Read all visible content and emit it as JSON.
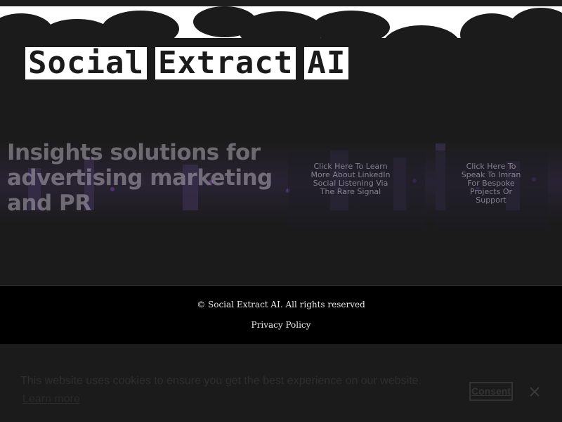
{
  "site": {
    "brand_words": [
      "Social",
      "Extract",
      "AI"
    ],
    "tagline": "Insights solutions for advertising marketing and PR"
  },
  "hero_links": [
    {
      "label": "Click Here To Learn More About LinkedIn Social Listening Via The Rare Signal"
    },
    {
      "label": "Click Here To Speak To Imran For Bespoke Projects Or Support"
    }
  ],
  "footer": {
    "copyright": "© Social Extract AI. All rights reserved",
    "privacy_label": "Privacy Policy"
  },
  "cookie_banner": {
    "message": "This website uses cookies to ensure you get the best experience on our website.",
    "learn_more": "Learn more",
    "consent": "Consent",
    "close_icon": "close-icon"
  },
  "colors": {
    "background": "#1b1b1b",
    "brand_fill": "#ffffff",
    "footer_bg": "#000000"
  }
}
